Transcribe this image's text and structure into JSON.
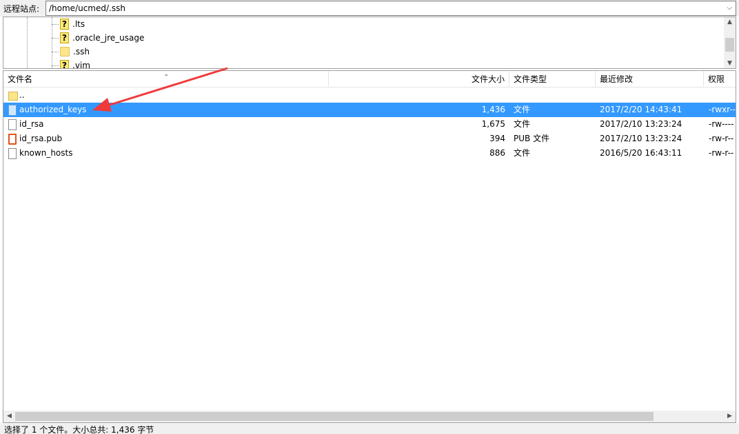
{
  "address_bar": {
    "label": "远程站点:",
    "path": "/home/ucmed/.ssh",
    "dropdown_icon": "chevron-down-icon"
  },
  "tree": {
    "items": [
      {
        "label": ".lts",
        "icon": "unknown-folder-icon"
      },
      {
        "label": ".oracle_jre_usage",
        "icon": "unknown-folder-icon"
      },
      {
        "label": ".ssh",
        "icon": "folder-icon"
      },
      {
        "label": ".vim",
        "icon": "unknown-folder-icon"
      }
    ]
  },
  "list": {
    "columns": {
      "name": "文件名",
      "size": "文件大小",
      "type": "文件类型",
      "modified": "最近修改",
      "perms": "权限"
    },
    "rows": [
      {
        "name": "..",
        "size": "",
        "type": "",
        "modified": "",
        "perms": "",
        "icon": "folder-icon",
        "selected": false
      },
      {
        "name": "authorized_keys",
        "size": "1,436",
        "type": "文件",
        "modified": "2017/2/20 14:43:41",
        "perms": "-rwxr--",
        "icon": "file-icon",
        "selected": true
      },
      {
        "name": "id_rsa",
        "size": "1,675",
        "type": "文件",
        "modified": "2017/2/10 13:23:24",
        "perms": "-rw----",
        "icon": "file-icon",
        "selected": false
      },
      {
        "name": "id_rsa.pub",
        "size": "394",
        "type": "PUB 文件",
        "modified": "2017/2/10 13:23:24",
        "perms": "-rw-r--",
        "icon": "office-file-icon",
        "selected": false
      },
      {
        "name": "known_hosts",
        "size": "886",
        "type": "文件",
        "modified": "2016/5/20 16:43:11",
        "perms": "-rw-r--",
        "icon": "file-icon",
        "selected": false
      }
    ]
  },
  "status": {
    "text": "选择了 1 个文件。大小总共: 1,436 字节"
  },
  "colors": {
    "selection": "#3399ff",
    "annotation_arrow": "#f03a3a"
  }
}
